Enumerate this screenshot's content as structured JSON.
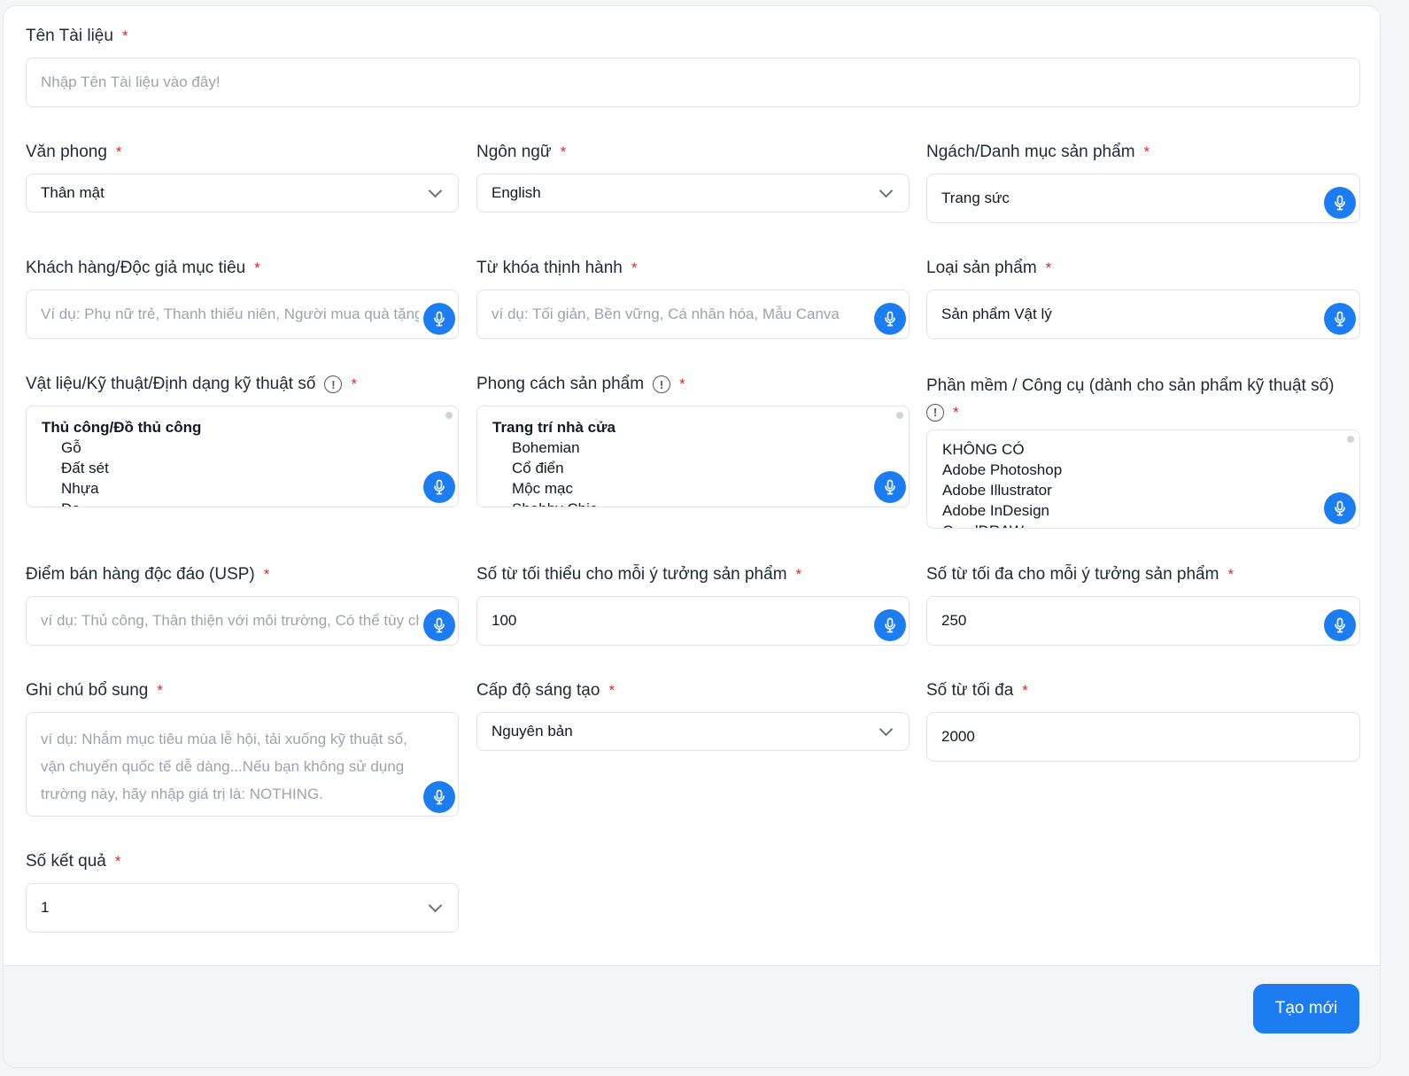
{
  "fields": {
    "doc_name": {
      "label": "Tên Tài liệu",
      "placeholder": "Nhập Tên Tài liệu vào đây!"
    },
    "tone": {
      "label": "Văn phong",
      "value": "Thân mật"
    },
    "language": {
      "label": "Ngôn ngữ",
      "value": "English"
    },
    "niche": {
      "label": "Ngách/Danh mục sản phẩm",
      "value": "Trang sức"
    },
    "audience": {
      "label": "Khách hàng/Độc giả mục tiêu",
      "placeholder": "Ví dụ: Phụ nữ trẻ, Thanh thiếu niên, Người mua quà tặng"
    },
    "keywords": {
      "label": "Từ khóa thịnh hành",
      "placeholder": "ví dụ: Tối giản, Bền vững, Cá nhân hóa, Mẫu Canva"
    },
    "product_type": {
      "label": "Loại sản phẩm",
      "value": "Sản phẩm Vật lý"
    },
    "materials": {
      "label": "Vật liệu/Kỹ thuật/Định dạng kỹ thuật số",
      "group": "Thủ công/Đồ thủ công",
      "options": [
        "Gỗ",
        "Đất sét",
        "Nhựa",
        "Da"
      ]
    },
    "style": {
      "label": "Phong cách sản phẩm",
      "group": "Trang trí nhà cửa",
      "options": [
        "Bohemian",
        "Cổ điển",
        "Mộc mạc",
        "Shabby Chic"
      ]
    },
    "software": {
      "label": "Phần mềm / Công cụ (dành cho sản phẩm kỹ thuật số)",
      "options": [
        "KHÔNG CÓ",
        "Adobe Photoshop",
        "Adobe Illustrator",
        "Adobe InDesign",
        "CorelDRAW"
      ]
    },
    "usp": {
      "label": "Điểm bán hàng độc đáo (USP)",
      "placeholder": "ví dụ: Thủ công, Thân thiện với môi trường, Có thể tùy chỉnh"
    },
    "min_words": {
      "label": "Số từ tối thiểu cho mỗi ý tưởng sản phẩm",
      "value": "100"
    },
    "max_words_idea": {
      "label": "Số từ tối đa cho mỗi ý tưởng sản phẩm",
      "value": "250"
    },
    "notes": {
      "label": "Ghi chú bổ sung",
      "placeholder": "ví dụ: Nhắm mục tiêu mùa lễ hội, tải xuống kỹ thuật số, vận chuyển quốc tế dễ dàng...Nếu bạn không sử dụng trường này, hãy nhập giá trị là: NOTHING."
    },
    "creativity": {
      "label": "Cấp độ sáng tạo",
      "value": "Nguyên bản"
    },
    "max_words": {
      "label": "Số từ tối đa",
      "value": "2000"
    },
    "results": {
      "label": "Số kết quả",
      "value": "1"
    }
  },
  "required_mark": "*",
  "info_glyph": "!",
  "submit_label": "Tạo mới",
  "colors": {
    "accent": "#1d7df0",
    "required": "#dc2626"
  },
  "icons": {
    "mic": "microphone-icon",
    "chevron": "chevron-down-icon",
    "info": "info-icon"
  }
}
